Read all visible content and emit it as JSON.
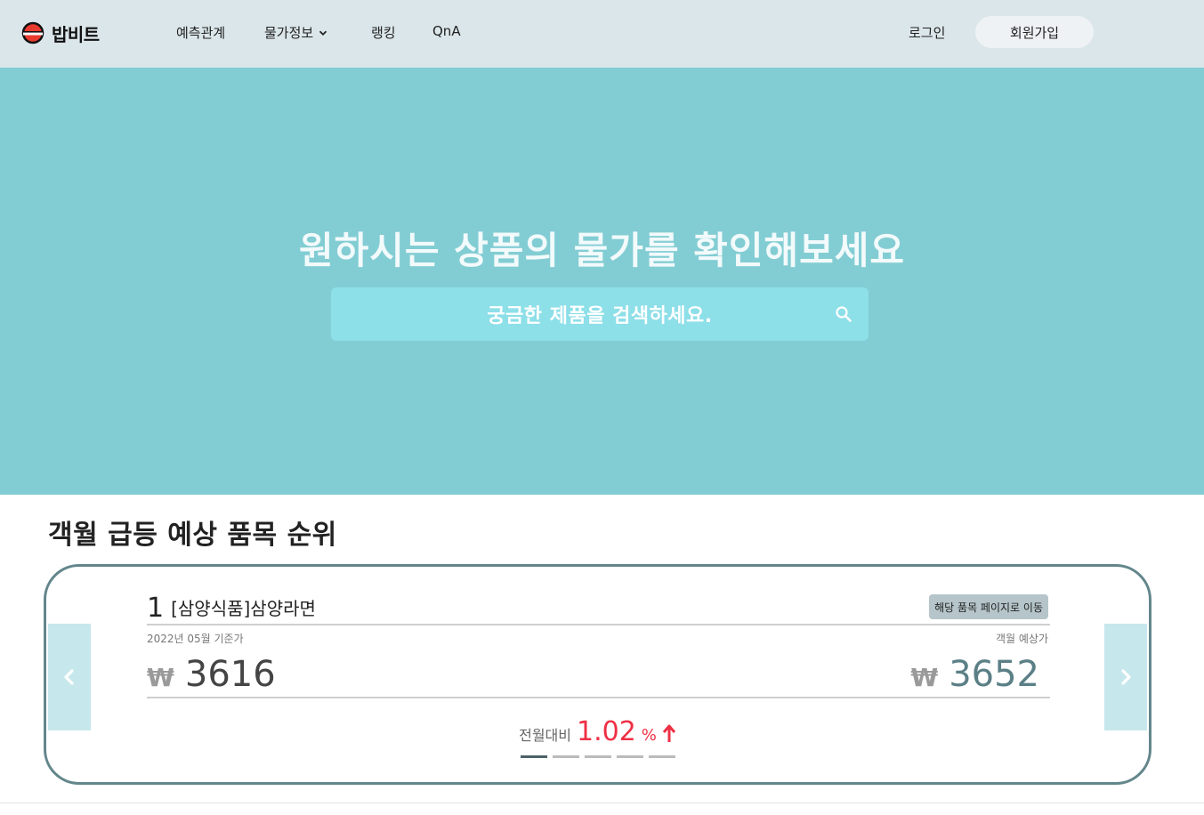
{
  "brand": {
    "name": "밥비트"
  },
  "nav": {
    "items": [
      {
        "label": "예측관계"
      },
      {
        "label": "물가정보"
      },
      {
        "label": "랭킹"
      },
      {
        "label": "QnA"
      }
    ],
    "login": "로그인",
    "signup": "회원가입"
  },
  "hero": {
    "title": "원하시는 상품의 물가를 확인해보세요",
    "search_placeholder": "궁금한 제품을 검색하세요."
  },
  "ranking": {
    "title": "객월 급등 예상 품목 순위",
    "item": {
      "rank": "1",
      "name": "[삼양식품]삼양라면",
      "goto_label": "해당 품목 페이지로 이동",
      "base_date": "2022년 05월 기준가",
      "pred_label": "객월 예상가",
      "currency": "₩",
      "current_price": "3616",
      "predicted_price": "3652",
      "change_label": "전월대비",
      "change_value": "1.02",
      "change_unit": "%"
    },
    "indicator_count": 5,
    "active_indicator": 1
  },
  "colors": {
    "header_bg": "#dbe6ea",
    "hero_bg": "#82cdd3",
    "search_bg": "#8ddfe8",
    "card_border": "#63868b",
    "accent_red": "#ee3045",
    "predicted_price": "#5b7f86"
  }
}
